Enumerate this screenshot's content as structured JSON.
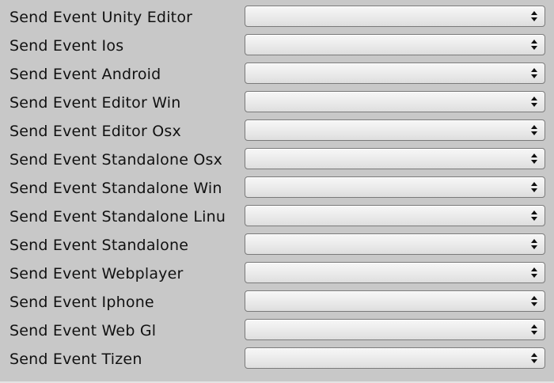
{
  "inspector": {
    "rows": [
      {
        "label": "Send Event Unity Editor",
        "value": ""
      },
      {
        "label": "Send Event Ios",
        "value": ""
      },
      {
        "label": "Send Event Android",
        "value": ""
      },
      {
        "label": "Send Event Editor Win",
        "value": ""
      },
      {
        "label": "Send Event Editor Osx",
        "value": ""
      },
      {
        "label": "Send Event Standalone Osx",
        "value": ""
      },
      {
        "label": "Send Event Standalone Win",
        "value": ""
      },
      {
        "label": "Send Event Standalone Linu",
        "value": ""
      },
      {
        "label": "Send Event Standalone",
        "value": ""
      },
      {
        "label": "Send Event Webplayer",
        "value": ""
      },
      {
        "label": "Send Event Iphone",
        "value": ""
      },
      {
        "label": "Send Event Web Gl",
        "value": ""
      },
      {
        "label": "Send Event Tizen",
        "value": ""
      }
    ],
    "dropdown_icon": "up-down-arrows-icon"
  }
}
